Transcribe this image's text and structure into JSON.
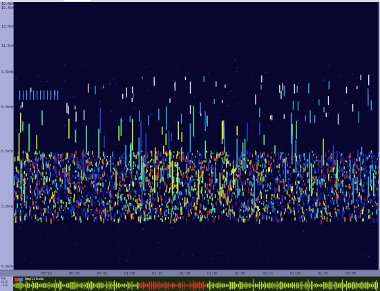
{
  "y_axis_ticks": [
    "15.6kHz",
    "15.4kHz",
    "13.0kHz",
    "11.5kHz",
    "9.5kHz",
    "8.0kHz",
    "6.5kHz",
    "3.0kHz",
    "0.0kHz"
  ],
  "time_ticks": [
    "00:15",
    "00:30",
    "00:45",
    "01:00",
    "01:15",
    "01:30",
    "01:45",
    "02:00",
    "02:15",
    "02:30",
    "02:45",
    "03:00"
  ],
  "waveform": {
    "legend_label": "Amplitude",
    "side_labels": [
      "Amp",
      "+4.0",
      "-4.0"
    ]
  },
  "colors": {
    "background": "#06062e",
    "axis": "#a9acd8",
    "wave": "#b8e032",
    "wave_highlight": "#e0352b"
  }
}
